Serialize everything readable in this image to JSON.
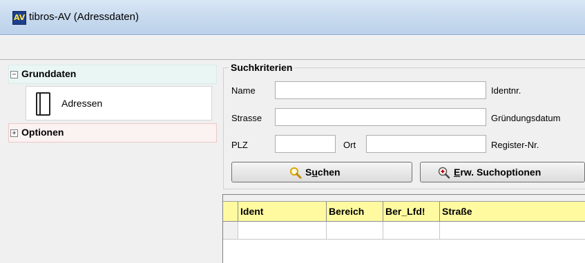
{
  "window": {
    "title": "tibros-AV  (Adressdaten)",
    "icon": "av-logo-icon"
  },
  "sidebar": {
    "groups": [
      {
        "label": "Grunddaten",
        "expander": "⊟",
        "items": [
          {
            "label": "Adressen",
            "icon": "document-icon"
          }
        ]
      },
      {
        "label": "Optionen",
        "expander": "⊞",
        "items": []
      }
    ]
  },
  "search": {
    "legend": "Suchkriterien",
    "fields": {
      "name": {
        "label": "Name",
        "value": ""
      },
      "strasse": {
        "label": "Strasse",
        "value": ""
      },
      "plz": {
        "label": "PLZ",
        "value": ""
      },
      "ort": {
        "label": "Ort",
        "value": ""
      },
      "identnr": {
        "label": "Identnr."
      },
      "gruendungsdatum": {
        "label": "Gründungsdatum"
      },
      "register_nr": {
        "label": "Register-Nr."
      }
    },
    "buttons": {
      "suchen": {
        "label_pre": "S",
        "label_accel": "u",
        "label_post": "chen",
        "icon": "magnifier-icon"
      },
      "erw": {
        "label_accel": "E",
        "label_post": "rw. Suchoptionen",
        "icon": "zoom-plus-icon"
      }
    }
  },
  "grid": {
    "columns": [
      "Ident",
      "Bereich",
      "Ber_Lfd!",
      "Straße"
    ],
    "rows": [
      [
        "",
        "",
        "",
        ""
      ]
    ]
  },
  "colors": {
    "grid_header_bg": "#fffaa0",
    "titlebar": "#c6d9ee",
    "grunddaten_bg": "#eaf6f4",
    "optionen_border": "#efc7c7"
  }
}
